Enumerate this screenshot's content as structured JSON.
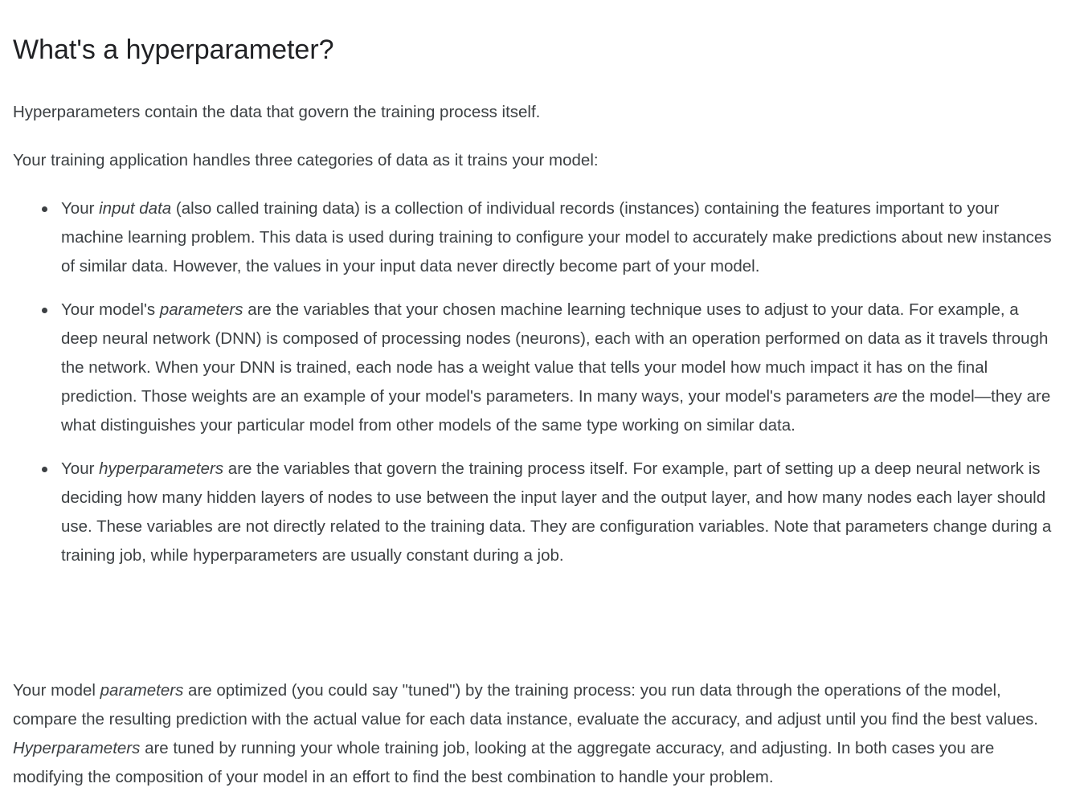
{
  "heading": "What's a hyperparameter?",
  "intro": "Hyperparameters contain the data that govern the training process itself.",
  "categories_lead": "Your training application handles three categories of data as it trains your model:",
  "bullets": [
    {
      "before": "Your ",
      "em": "input data",
      "after": " (also called training data) is a collection of individual records (instances) containing the features important to your machine learning problem. This data is used during training to configure your model to accurately make predictions about new instances of similar data. However, the values in your input data never directly become part of your model."
    },
    {
      "before": "Your model's ",
      "em": "parameters",
      "middle": " are the variables that your chosen machine learning technique uses to adjust to your data. For example, a deep neural network (DNN) is composed of processing nodes (neurons), each with an operation performed on data as it travels through the network. When your DNN is trained, each node has a weight value that tells your model how much impact it has on the final prediction. Those weights are an example of your model's parameters. In many ways, your model's parameters ",
      "em2": "are",
      "after": " the model—they are what distinguishes your particular model from other models of the same type working on similar data."
    },
    {
      "before": "Your ",
      "em": "hyperparameters",
      "after": " are the variables that govern the training process itself. For example, part of setting up a deep neural network is deciding how many hidden layers of nodes to use between the input layer and the output layer, and how many nodes each layer should use. These variables are not directly related to the training data. They are configuration variables. Note that parameters change during a training job, while hyperparameters are usually constant during a job."
    }
  ],
  "final": {
    "before": "Your model ",
    "em": "parameters",
    "middle": " are optimized (you could say \"tuned\") by the training process: you run data through the operations of the model, compare the resulting prediction with the actual value for each data instance, evaluate the accuracy, and adjust until you find the best values. ",
    "em2": "Hyperparameters",
    "after": " are tuned by running your whole training job, looking at the aggregate accuracy, and adjusting. In both cases you are modifying the composition of your model in an effort to find the best combination to handle your problem."
  }
}
